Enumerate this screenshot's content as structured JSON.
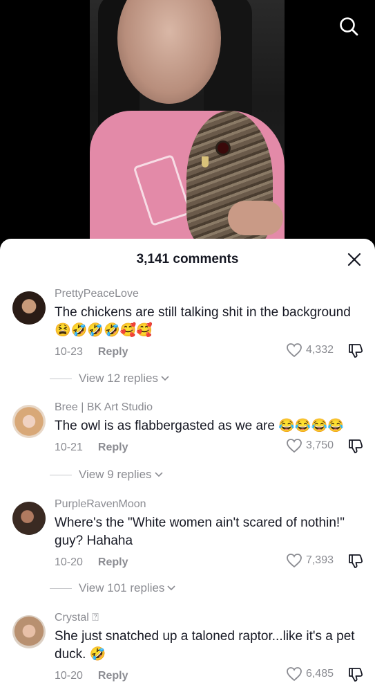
{
  "header": {
    "comment_count": "3,141 comments"
  },
  "icons": {
    "search": "search-icon",
    "close": "close-icon",
    "heart": "heart-icon",
    "dislike": "thumbs-down-icon",
    "chevron": "chevron-down-icon"
  },
  "comments": [
    {
      "username": "PrettyPeaceLove",
      "text": "The chickens are still talking shit in the background 😫🤣🤣🤣🥰🥰",
      "date": "10-23",
      "reply": "Reply",
      "likes": "4,332",
      "view_replies": "View 12 replies",
      "avatar_color": "#3a2a22"
    },
    {
      "username": "Bree | BK Art Studio",
      "text": "The owl is as flabbergasted as we are 😂😂😂😂",
      "date": "10-21",
      "reply": "Reply",
      "likes": "3,750",
      "view_replies": "View 9 replies",
      "avatar_color": "#d8b8a0"
    },
    {
      "username": "PurpleRavenMoon",
      "text": "Where's the \"White women ain't scared of nothin!\" guy? Hahaha",
      "date": "10-20",
      "reply": "Reply",
      "likes": "7,393",
      "view_replies": "View 101 replies",
      "avatar_color": "#4a3a30"
    },
    {
      "username": "Crystal ⍰",
      "text": "She just snatched up a taloned raptor...like it's a pet duck. 🤣",
      "date": "10-20",
      "reply": "Reply",
      "likes": "6,485",
      "view_replies": "",
      "avatar_color": "#c8a890"
    }
  ]
}
